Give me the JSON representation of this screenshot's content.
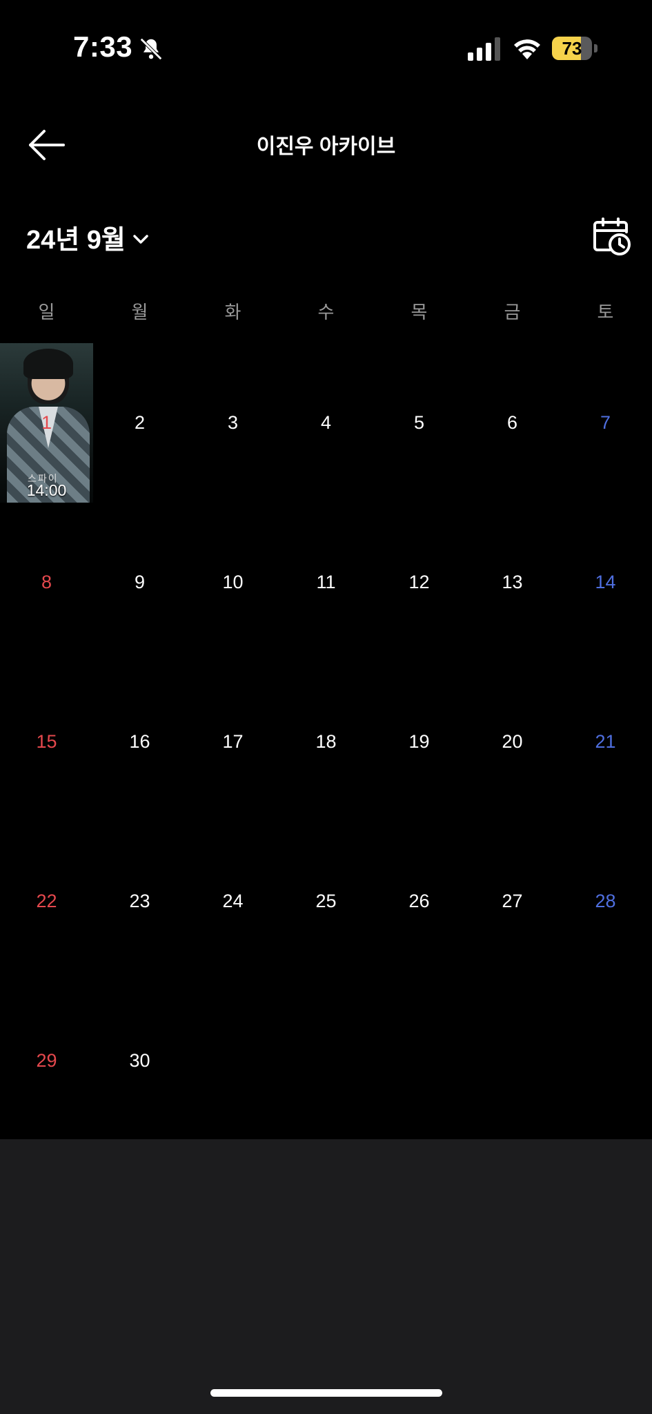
{
  "status_bar": {
    "time": "7:33",
    "battery": "73",
    "battery_level": 0.73,
    "icons": [
      "bell-slash-icon",
      "cellular-signal-icon",
      "wifi-icon",
      "battery-icon"
    ]
  },
  "header": {
    "title": "이진우 아카이브",
    "back_icon": "arrow-left-icon"
  },
  "calendar": {
    "month_label": "24년 9월",
    "schedule_icon": "calendar-clock-icon",
    "weekdays": [
      "일",
      "월",
      "화",
      "수",
      "목",
      "금",
      "토"
    ],
    "weeks": [
      [
        {
          "d": "1",
          "event_time": "14:00",
          "poster_text": "스파이"
        },
        {
          "d": "2"
        },
        {
          "d": "3"
        },
        {
          "d": "4"
        },
        {
          "d": "5"
        },
        {
          "d": "6"
        },
        {
          "d": "7"
        }
      ],
      [
        {
          "d": "8"
        },
        {
          "d": "9"
        },
        {
          "d": "10"
        },
        {
          "d": "11"
        },
        {
          "d": "12"
        },
        {
          "d": "13"
        },
        {
          "d": "14"
        }
      ],
      [
        {
          "d": "15"
        },
        {
          "d": "16"
        },
        {
          "d": "17"
        },
        {
          "d": "18"
        },
        {
          "d": "19"
        },
        {
          "d": "20"
        },
        {
          "d": "21"
        }
      ],
      [
        {
          "d": "22"
        },
        {
          "d": "23"
        },
        {
          "d": "24"
        },
        {
          "d": "25"
        },
        {
          "d": "26"
        },
        {
          "d": "27"
        },
        {
          "d": "28"
        }
      ],
      [
        {
          "d": "29"
        },
        {
          "d": "30"
        },
        {
          "d": ""
        },
        {
          "d": ""
        },
        {
          "d": ""
        },
        {
          "d": ""
        },
        {
          "d": ""
        }
      ]
    ]
  },
  "colors": {
    "background": "#000000",
    "sunday": "#e5484d",
    "saturday": "#4f6fe0",
    "bottom_sheet": "#1c1c1e",
    "battery": "#f5d24b"
  }
}
